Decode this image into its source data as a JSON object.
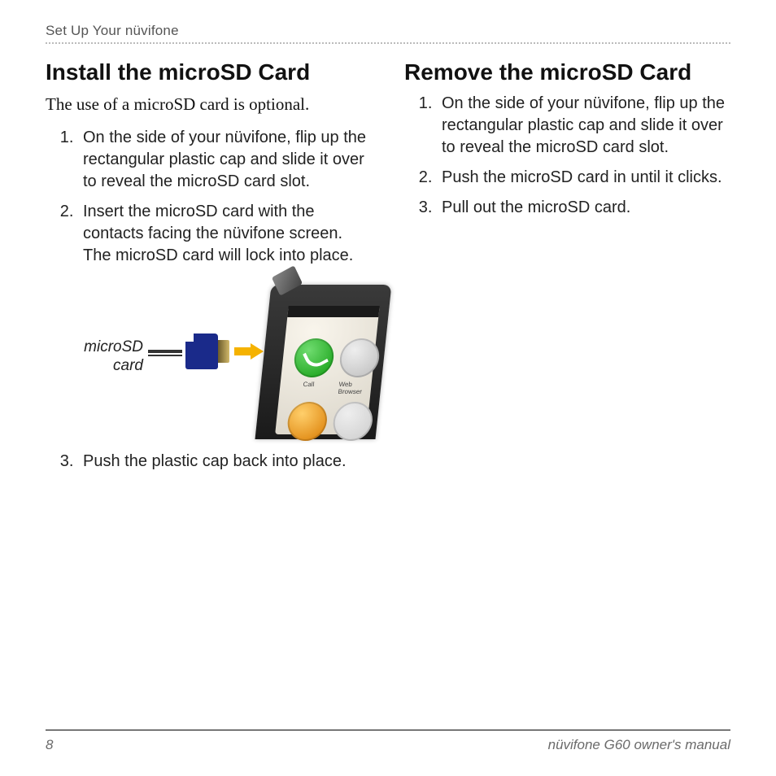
{
  "header": {
    "running_head": "Set Up Your nüvifone"
  },
  "left": {
    "heading": "Install the microSD Card",
    "intro": "The use of a microSD card is optional.",
    "steps_a": [
      "On the side of your nüvifone, flip up the rectangular plastic cap and slide it over to reveal the microSD card slot.",
      "Insert the microSD card with the contacts facing the nüvifone screen. The microSD card will lock into place."
    ],
    "figure_label": "microSD card",
    "phone": {
      "icon_call_label": "Call",
      "icon_go_label": "Web Browser"
    },
    "steps_b": [
      "Push the plastic cap back into place."
    ]
  },
  "right": {
    "heading": "Remove the microSD Card",
    "steps": [
      "On the side of your nüvifone, flip up the rectangular plastic cap and slide it over to reveal the microSD card slot.",
      "Push the microSD card in until it clicks.",
      "Pull out the microSD card."
    ]
  },
  "footer": {
    "page_number": "8",
    "manual_title": "nüvifone G60 owner's manual"
  }
}
